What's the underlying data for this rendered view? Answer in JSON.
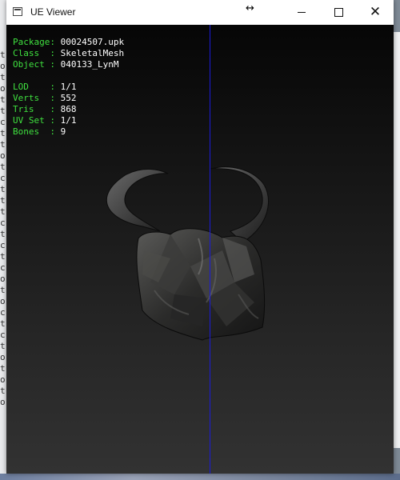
{
  "window": {
    "title": "UE Viewer",
    "controls": {
      "minimize": "minimize",
      "maximize": "maximize",
      "close": "✕"
    }
  },
  "info": {
    "group1": [
      {
        "key": "Package",
        "value": "00024507.upk"
      },
      {
        "key": "Class  ",
        "value": "SkeletalMesh"
      },
      {
        "key": "Object ",
        "value": "040133_LynM"
      }
    ],
    "group2": [
      {
        "key": "LOD    ",
        "value": "1/1"
      },
      {
        "key": "Verts  ",
        "value": "552"
      },
      {
        "key": "Tris   ",
        "value": "868"
      },
      {
        "key": "UV Set ",
        "value": "1/1"
      },
      {
        "key": "Bones  ",
        "value": "9"
      }
    ]
  },
  "background_left_glyphs": [
    "t",
    "o",
    "t",
    "o",
    "t",
    "t",
    "c",
    "t",
    "t",
    "o",
    "t",
    "c",
    "t",
    "t",
    "t",
    "c",
    "t",
    "c",
    "t",
    "c",
    "o",
    "t",
    "o",
    "c",
    "t",
    "c",
    "t",
    "o",
    "t",
    "o",
    "t",
    "o"
  ],
  "colors": {
    "axis": "#1b1bd8",
    "label": "#3fe03f",
    "value": "#ffffff"
  }
}
